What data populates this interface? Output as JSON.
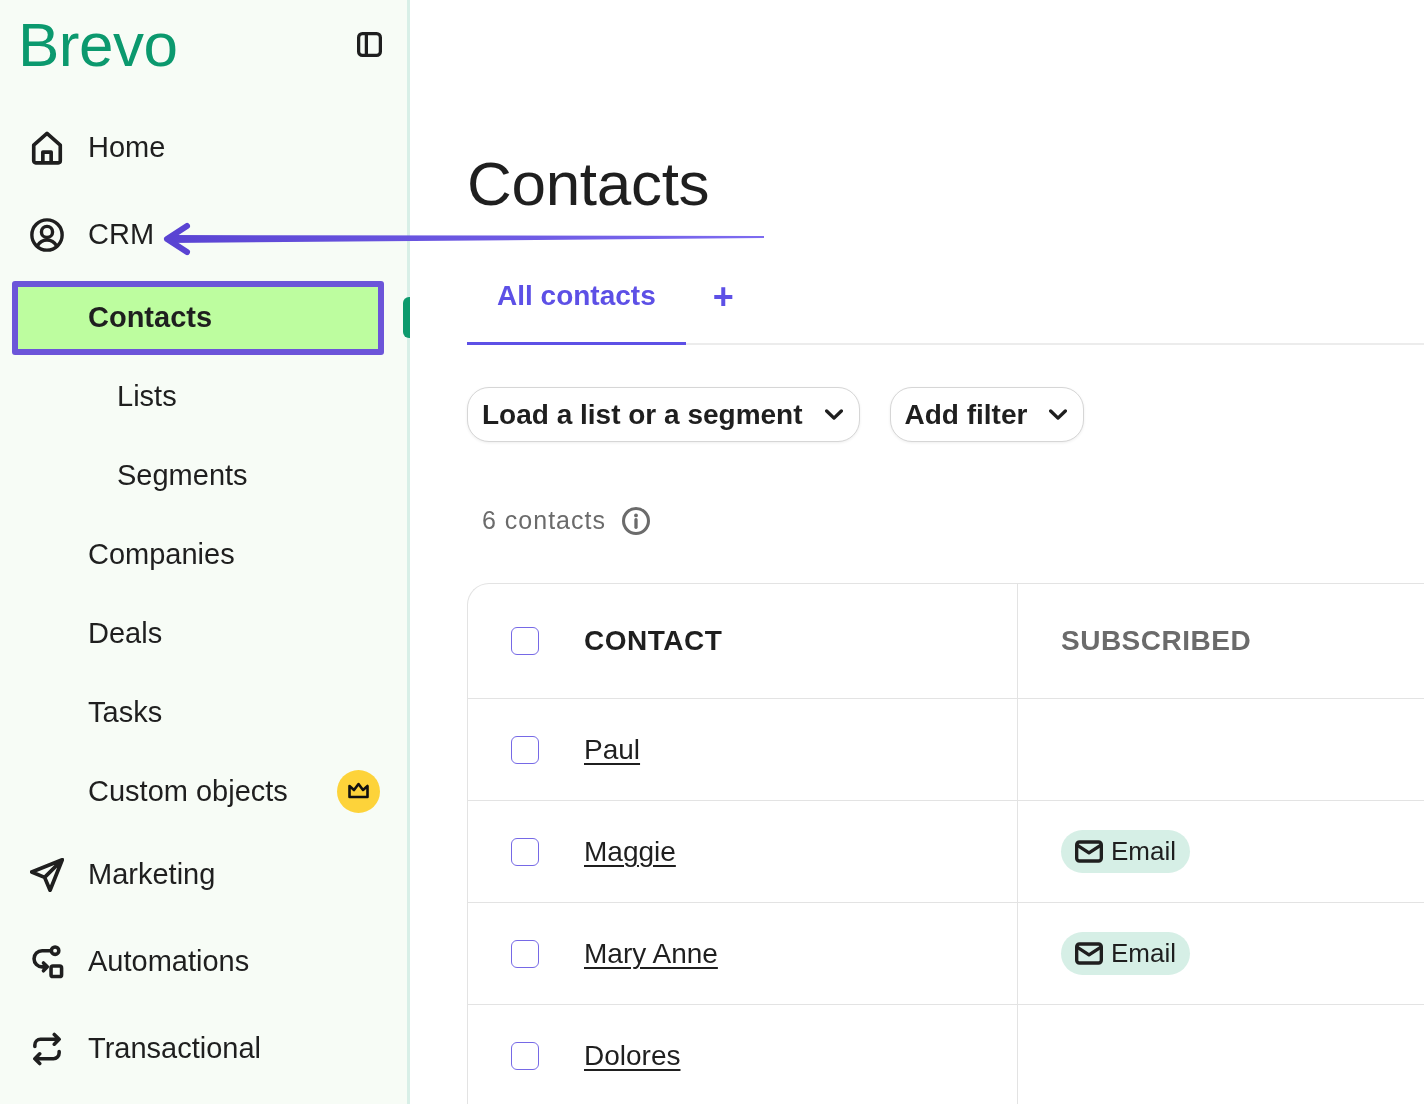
{
  "sidebar": {
    "logo": "Brevo",
    "nav": [
      {
        "label": "Home",
        "selected": false
      },
      {
        "label": "CRM",
        "selected": false,
        "children": [
          {
            "label": "Contacts",
            "selected": true,
            "highlighted": true,
            "premium": false,
            "children": [
              {
                "label": "Lists",
                "selected": false
              },
              {
                "label": "Segments",
                "selected": false
              }
            ]
          },
          {
            "label": "Companies",
            "selected": false,
            "highlighted": false,
            "premium": false
          },
          {
            "label": "Deals",
            "selected": false,
            "highlighted": false,
            "premium": false
          },
          {
            "label": "Tasks",
            "selected": false,
            "highlighted": false,
            "premium": false
          },
          {
            "label": "Custom objects",
            "selected": false,
            "highlighted": false,
            "premium": true
          }
        ]
      },
      {
        "label": "Marketing",
        "selected": false
      },
      {
        "label": "Automations",
        "selected": false
      },
      {
        "label": "Transactional",
        "selected": false
      }
    ]
  },
  "page": {
    "title": "Contacts",
    "tabs": [
      {
        "label": "All contacts",
        "selected": true
      }
    ],
    "add_tab": "+",
    "filters": [
      {
        "label": "Load a list or a segment"
      },
      {
        "label": "Add filter"
      }
    ],
    "count": "6 contacts"
  },
  "table": {
    "header_checked": false,
    "columns": [
      {
        "label": "CONTACT",
        "active": true
      },
      {
        "label": "SUBSCRIBED",
        "active": false
      }
    ],
    "rows": [
      {
        "name": "Paul",
        "checked": false
      },
      {
        "name": "Maggie",
        "checked": false,
        "subscribed": [
          "Email"
        ]
      },
      {
        "name": "Mary Anne",
        "checked": false,
        "subscribed": [
          "Email"
        ]
      },
      {
        "name": "Dolores",
        "checked": false
      }
    ]
  }
}
